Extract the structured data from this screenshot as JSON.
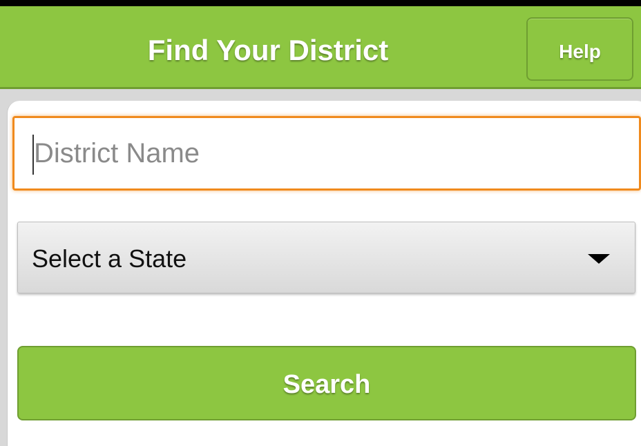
{
  "header": {
    "title": "Find Your District",
    "help_label": "Help"
  },
  "form": {
    "district_input": {
      "value": "",
      "placeholder": "District Name"
    },
    "state_select": {
      "selected": "Select a State"
    },
    "search_label": "Search"
  },
  "colors": {
    "brand_green": "#8dc641",
    "focus_orange": "#f08a1d"
  },
  "icons": {
    "dropdown": "chevron-down-icon"
  }
}
